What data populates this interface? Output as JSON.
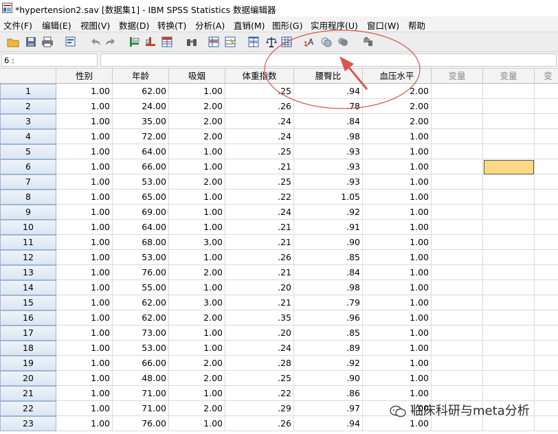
{
  "window": {
    "title": "*hypertension2.sav [数据集1] - IBM SPSS Statistics 数据编辑器"
  },
  "menu": [
    {
      "label": "文件(F)"
    },
    {
      "label": "编辑(E)"
    },
    {
      "label": "视图(V)"
    },
    {
      "label": "数据(D)"
    },
    {
      "label": "转换(T)"
    },
    {
      "label": "分析(A)"
    },
    {
      "label": "直销(M)"
    },
    {
      "label": "图形(G)"
    },
    {
      "label": "实用程序(U)"
    },
    {
      "label": "窗口(W)"
    },
    {
      "label": "帮助"
    }
  ],
  "toolbar": {
    "icons": [
      "open-folder-icon",
      "save-icon",
      "print-icon",
      "dialog-recall-icon",
      "undo-icon",
      "redo-icon",
      "goto-case-icon",
      "goto-variable-icon",
      "variables-icon",
      "find-icon",
      "insert-cases-icon",
      "insert-variable-icon",
      "split-file-icon",
      "weight-cases-icon",
      "select-cases-icon",
      "value-labels-icon",
      "use-variable-sets-icon",
      "show-all-variables-icon",
      "spell-check-icon"
    ]
  },
  "cell_reference": {
    "value": "6 :"
  },
  "grid": {
    "columns": [
      "性别",
      "年龄",
      "吸烟",
      "体重指数",
      "腰臀比",
      "血压水平",
      "变量",
      "变量",
      "变"
    ],
    "rows": [
      {
        "n": "1",
        "cells": [
          "1.00",
          "62.00",
          "1.00",
          ".25",
          ".94",
          "2.00"
        ]
      },
      {
        "n": "2",
        "cells": [
          "1.00",
          "24.00",
          "2.00",
          ".26",
          ".78",
          "2.00"
        ]
      },
      {
        "n": "3",
        "cells": [
          "1.00",
          "35.00",
          "2.00",
          ".24",
          ".84",
          "2.00"
        ]
      },
      {
        "n": "4",
        "cells": [
          "1.00",
          "72.00",
          "2.00",
          ".24",
          ".98",
          "1.00"
        ]
      },
      {
        "n": "5",
        "cells": [
          "1.00",
          "64.00",
          "1.00",
          ".25",
          ".93",
          "1.00"
        ]
      },
      {
        "n": "6",
        "cells": [
          "1.00",
          "66.00",
          "1.00",
          ".21",
          ".93",
          "1.00"
        ]
      },
      {
        "n": "7",
        "cells": [
          "1.00",
          "53.00",
          "2.00",
          ".25",
          ".93",
          "1.00"
        ]
      },
      {
        "n": "8",
        "cells": [
          "1.00",
          "65.00",
          "1.00",
          ".22",
          "1.05",
          "1.00"
        ]
      },
      {
        "n": "9",
        "cells": [
          "1.00",
          "69.00",
          "1.00",
          ".24",
          ".92",
          "1.00"
        ]
      },
      {
        "n": "10",
        "cells": [
          "1.00",
          "64.00",
          "1.00",
          ".21",
          ".91",
          "1.00"
        ]
      },
      {
        "n": "11",
        "cells": [
          "1.00",
          "68.00",
          "3.00",
          ".21",
          ".90",
          "1.00"
        ]
      },
      {
        "n": "12",
        "cells": [
          "1.00",
          "53.00",
          "1.00",
          ".26",
          ".85",
          "1.00"
        ]
      },
      {
        "n": "13",
        "cells": [
          "1.00",
          "76.00",
          "2.00",
          ".21",
          ".84",
          "1.00"
        ]
      },
      {
        "n": "14",
        "cells": [
          "1.00",
          "55.00",
          "1.00",
          ".20",
          ".98",
          "1.00"
        ]
      },
      {
        "n": "15",
        "cells": [
          "1.00",
          "62.00",
          "3.00",
          ".21",
          ".79",
          "1.00"
        ]
      },
      {
        "n": "16",
        "cells": [
          "1.00",
          "62.00",
          "2.00",
          ".35",
          ".96",
          "1.00"
        ]
      },
      {
        "n": "17",
        "cells": [
          "1.00",
          "73.00",
          "1.00",
          ".20",
          ".85",
          "1.00"
        ]
      },
      {
        "n": "18",
        "cells": [
          "1.00",
          "53.00",
          "1.00",
          ".24",
          ".89",
          "1.00"
        ]
      },
      {
        "n": "19",
        "cells": [
          "1.00",
          "66.00",
          "2.00",
          ".28",
          ".92",
          "1.00"
        ]
      },
      {
        "n": "20",
        "cells": [
          "1.00",
          "48.00",
          "2.00",
          ".25",
          ".90",
          "1.00"
        ]
      },
      {
        "n": "21",
        "cells": [
          "1.00",
          "71.00",
          "1.00",
          ".22",
          ".86",
          "1.00"
        ]
      },
      {
        "n": "22",
        "cells": [
          "1.00",
          "71.00",
          "2.00",
          ".29",
          ".97",
          "1.00"
        ]
      },
      {
        "n": "23",
        "cells": [
          "1.00",
          "76.00",
          "1.00",
          ".26",
          ".94",
          "1.00"
        ]
      }
    ],
    "selected": {
      "row": "6",
      "column": "变量"
    }
  },
  "colors": {
    "selected_cell": "#fcd982",
    "annotation": "#d9534f"
  },
  "watermark": {
    "text": "临床科研与meta分析"
  }
}
